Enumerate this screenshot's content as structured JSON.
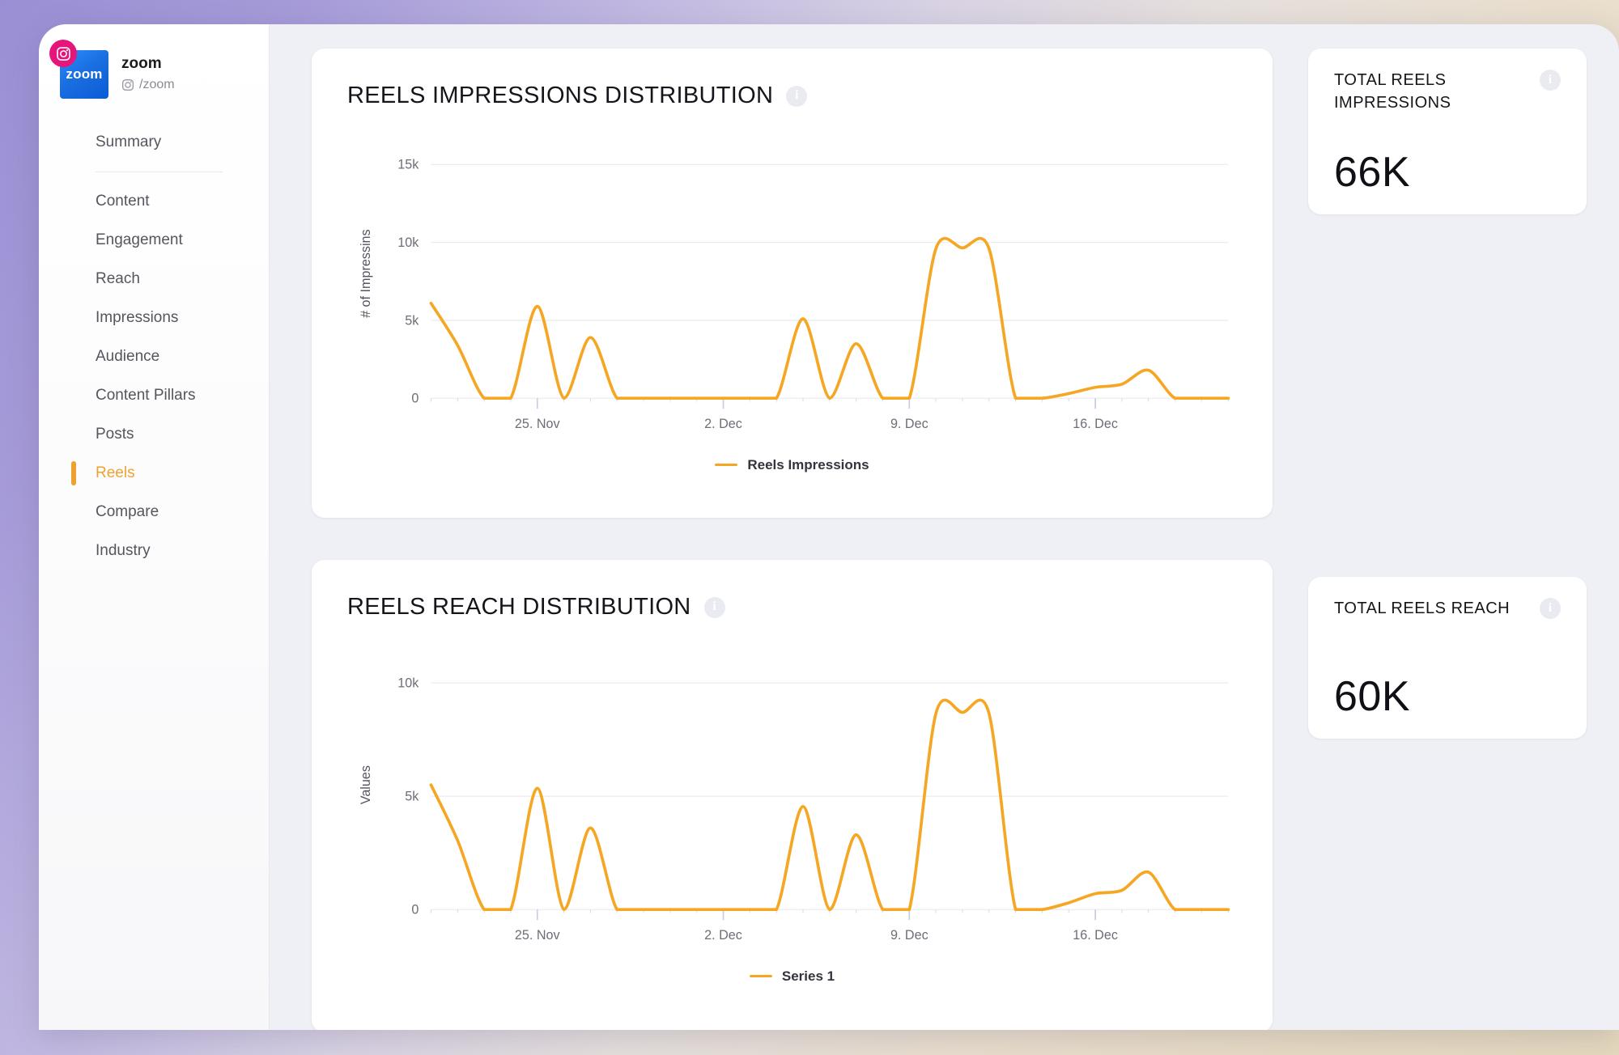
{
  "profile": {
    "name": "zoom",
    "handle": "/zoom",
    "avatar_text": "zoom",
    "network_icon": "instagram-icon",
    "handle_icon": "instagram-outline-icon",
    "badge_color": "#e6157a",
    "avatar_color": "#1a6fe0"
  },
  "sidebar": {
    "items": [
      {
        "label": "Summary",
        "active": false
      },
      {
        "label": "Content",
        "active": false
      },
      {
        "label": "Engagement",
        "active": false
      },
      {
        "label": "Reach",
        "active": false
      },
      {
        "label": "Impressions",
        "active": false
      },
      {
        "label": "Audience",
        "active": false
      },
      {
        "label": "Content Pillars",
        "active": false
      },
      {
        "label": "Posts",
        "active": false
      },
      {
        "label": "Reels",
        "active": true
      },
      {
        "label": "Compare",
        "active": false
      },
      {
        "label": "Industry",
        "active": false
      }
    ],
    "active_color": "#efa02f"
  },
  "charts": [
    {
      "title": "REELS IMPRESSIONS DISTRIBUTION",
      "info_icon": "info-icon",
      "legend_label": "Reels Impressions"
    },
    {
      "title": "REELS REACH DISTRIBUTION",
      "info_icon": "info-icon",
      "legend_label": "Series 1"
    }
  ],
  "kpis": [
    {
      "label": "TOTAL REELS IMPRESSIONS",
      "value": "66K",
      "info_icon": "info-icon"
    },
    {
      "label": "TOTAL REELS REACH",
      "value": "60K",
      "info_icon": "info-icon"
    }
  ],
  "chart_data": [
    {
      "type": "line",
      "title": "REELS IMPRESSIONS DISTRIBUTION",
      "xlabel": "",
      "ylabel": "# of Impressins",
      "ylim": [
        0,
        16000
      ],
      "yticks": [
        0,
        5000,
        10000,
        15000
      ],
      "ytick_labels": [
        "0",
        "5k",
        "10k",
        "15k"
      ],
      "xtick_labels": [
        "25. Nov",
        "2. Dec",
        "9. Dec",
        "16. Dec"
      ],
      "xtick_index": [
        4,
        11,
        18,
        25
      ],
      "grid": true,
      "legend_position": "bottom",
      "line_color": "#f5a623",
      "series": [
        {
          "name": "Reels Impressions",
          "x": [
            "21. Nov",
            "22. Nov",
            "23. Nov",
            "24. Nov",
            "25. Nov",
            "26. Nov",
            "27. Nov",
            "28. Nov",
            "29. Nov",
            "30. Nov",
            "1. Dec",
            "2. Dec",
            "3. Dec",
            "4. Dec",
            "5. Dec",
            "6. Dec",
            "7. Dec",
            "8. Dec",
            "9. Dec",
            "10. Dec",
            "11. Dec",
            "12. Dec",
            "13. Dec",
            "14. Dec",
            "15. Dec",
            "16. Dec",
            "17. Dec",
            "18. Dec",
            "19. Dec",
            "20. Dec",
            "21. Dec"
          ],
          "values": [
            6100,
            3400,
            0,
            0,
            5900,
            0,
            3900,
            0,
            0,
            0,
            0,
            0,
            0,
            0,
            5100,
            0,
            3500,
            0,
            0,
            9600,
            9650,
            9600,
            0,
            0,
            300,
            700,
            900,
            1800,
            0,
            0,
            0
          ]
        }
      ]
    },
    {
      "type": "line",
      "title": "REELS REACH DISTRIBUTION",
      "xlabel": "",
      "ylabel": "Values",
      "ylim": [
        0,
        11000
      ],
      "yticks": [
        0,
        5000,
        10000
      ],
      "ytick_labels": [
        "0",
        "5k",
        "10k"
      ],
      "xtick_labels": [
        "25. Nov",
        "2. Dec",
        "9. Dec",
        "16. Dec"
      ],
      "xtick_index": [
        4,
        11,
        18,
        25
      ],
      "grid": true,
      "legend_position": "bottom",
      "line_color": "#f5a623",
      "series": [
        {
          "name": "Series 1",
          "x": [
            "21. Nov",
            "22. Nov",
            "23. Nov",
            "24. Nov",
            "25. Nov",
            "26. Nov",
            "27. Nov",
            "28. Nov",
            "29. Nov",
            "30. Nov",
            "1. Dec",
            "2. Dec",
            "3. Dec",
            "4. Dec",
            "5. Dec",
            "6. Dec",
            "7. Dec",
            "8. Dec",
            "9. Dec",
            "10. Dec",
            "11. Dec",
            "12. Dec",
            "13. Dec",
            "14. Dec",
            "15. Dec",
            "16. Dec",
            "17. Dec",
            "18. Dec",
            "19. Dec",
            "20. Dec",
            "21. Dec"
          ],
          "values": [
            5500,
            3050,
            0,
            0,
            5350,
            0,
            3600,
            0,
            0,
            0,
            0,
            0,
            0,
            0,
            4550,
            0,
            3300,
            0,
            0,
            8650,
            8700,
            8650,
            0,
            0,
            300,
            700,
            850,
            1650,
            0,
            0,
            0
          ]
        }
      ]
    }
  ]
}
